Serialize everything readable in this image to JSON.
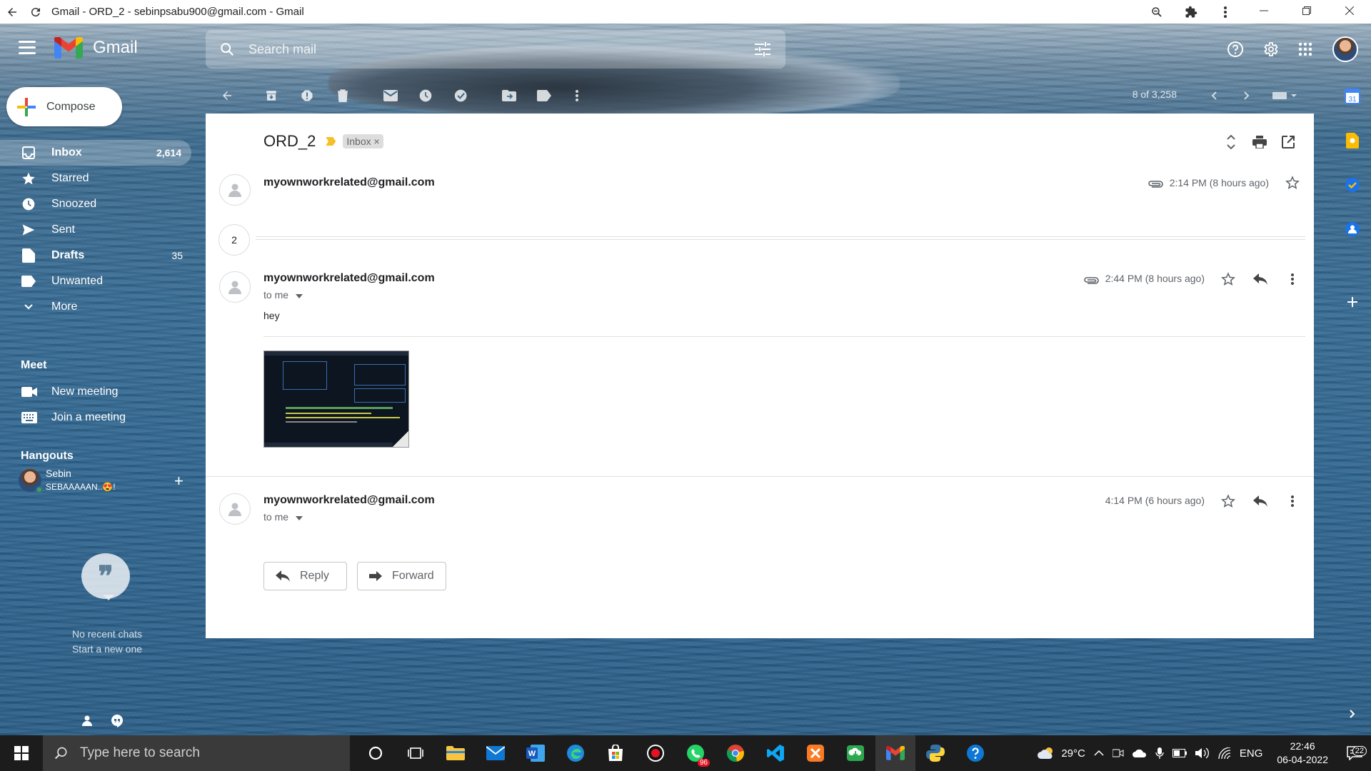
{
  "browser": {
    "tab_title": "Gmail - ORD_2 - sebinpsabu900@gmail.com - Gmail"
  },
  "header": {
    "brand": "Gmail",
    "search_placeholder": "Search mail"
  },
  "sidebar": {
    "compose_label": "Compose",
    "items": [
      {
        "label": "Inbox",
        "count": "2,614"
      },
      {
        "label": "Starred",
        "count": ""
      },
      {
        "label": "Snoozed",
        "count": ""
      },
      {
        "label": "Sent",
        "count": ""
      },
      {
        "label": "Drafts",
        "count": "35"
      },
      {
        "label": "Unwanted",
        "count": ""
      },
      {
        "label": "More",
        "count": ""
      }
    ],
    "meet": {
      "title": "Meet",
      "new_meeting": "New meeting",
      "join_meeting": "Join a meeting"
    },
    "hangouts": {
      "title": "Hangouts",
      "user_name": "Sebin",
      "user_status": "SEBAAAAAN..😍!",
      "quote_glyph": "❞",
      "no_recent": "No recent chats",
      "start_new": "Start a new one"
    }
  },
  "toolbar": {
    "pager": "8 of 3,258"
  },
  "thread": {
    "subject": "ORD_2",
    "label": "Inbox",
    "label_close": "×",
    "collapsed_count": "2",
    "messages": [
      {
        "from": "myownworkrelated@gmail.com",
        "time": "2:14 PM (8 hours ago)"
      },
      {
        "from": "myownworkrelated@gmail.com",
        "time": "2:44 PM (8 hours ago)",
        "to": "to me",
        "body": "hey"
      },
      {
        "from": "myownworkrelated@gmail.com",
        "time": "4:14 PM (6 hours ago)",
        "to": "to me"
      }
    ],
    "reply_label": "Reply",
    "forward_label": "Forward"
  },
  "taskbar": {
    "search_placeholder": "Type here to search",
    "whatsapp_badge": "96",
    "weather": "29°C",
    "language": "ENG",
    "time": "22:46",
    "date": "06-04-2022",
    "notifications": "22"
  }
}
